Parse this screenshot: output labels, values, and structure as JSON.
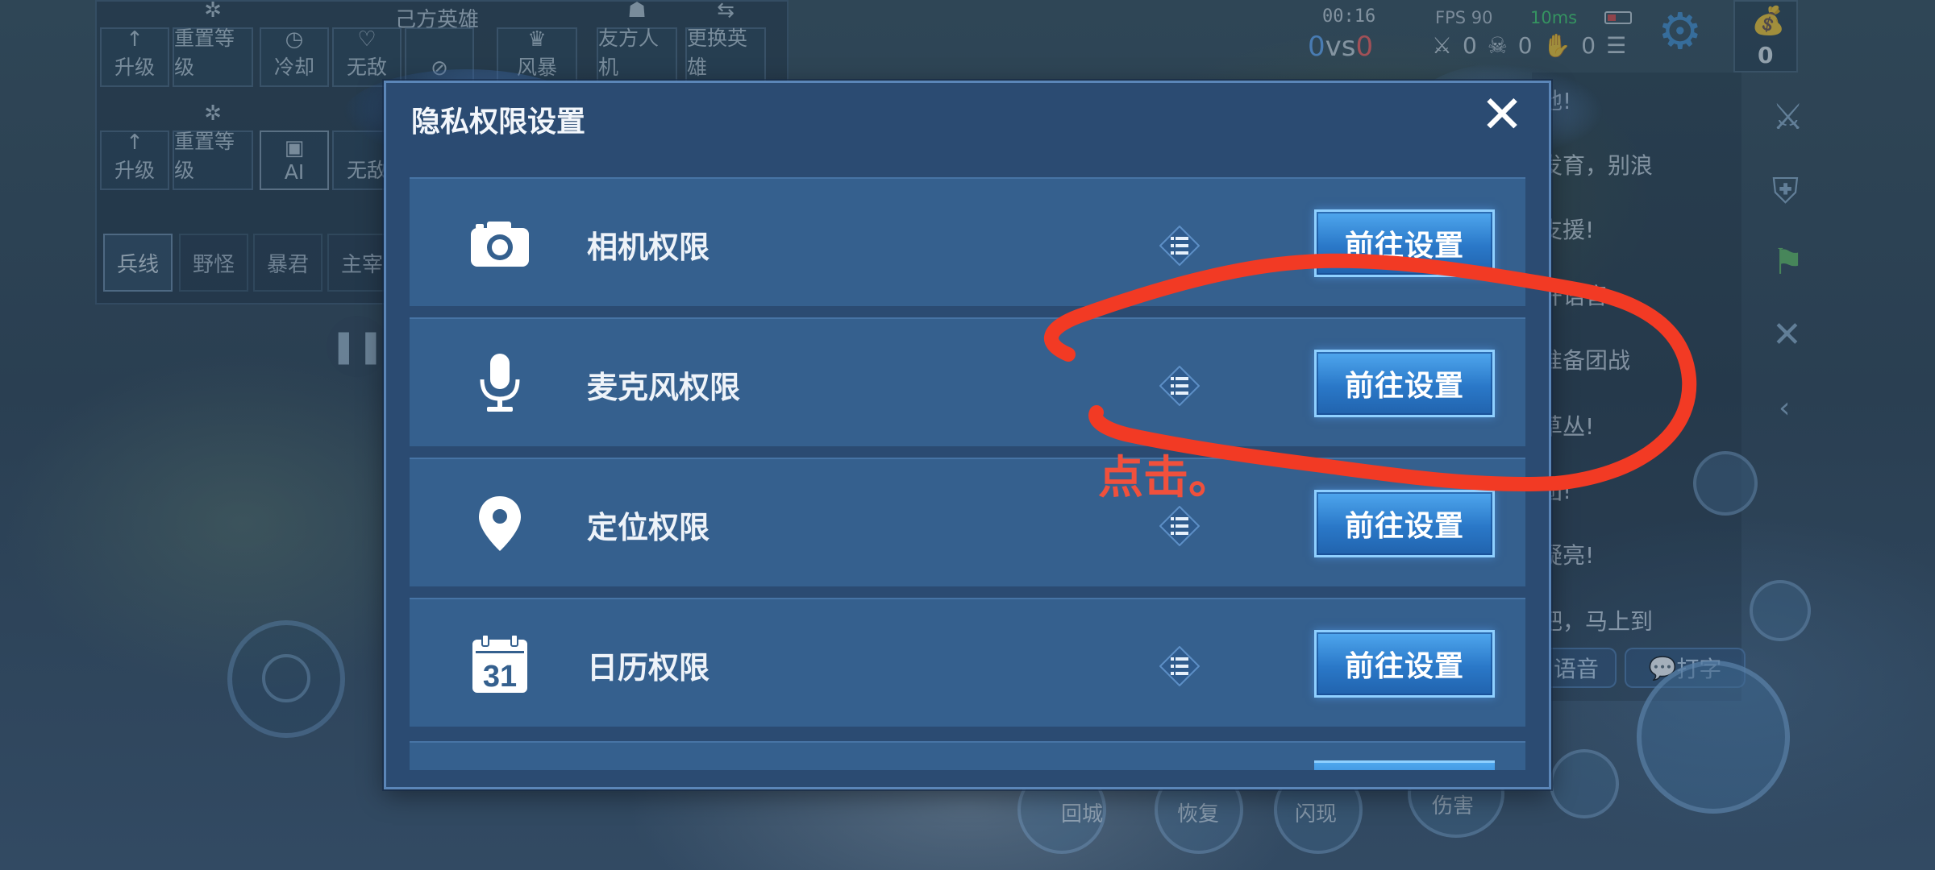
{
  "background": {
    "cheat_panel": {
      "title": "己方英雄",
      "row1": [
        {
          "icon": "arrow-up-icon",
          "label": "升级"
        },
        {
          "icon": "gear-small-icon",
          "label": "重置等级"
        },
        {
          "icon": "clock-icon",
          "label": "冷却"
        },
        {
          "icon": "heart-icon",
          "label": "无敌"
        },
        {
          "icon": "no-icon",
          "label": ""
        },
        {
          "icon": "storm-icon",
          "label": "风暴"
        },
        {
          "icon": "helmet-icon",
          "label": "友方人机"
        },
        {
          "icon": "swap-icon",
          "label": "更换英雄"
        }
      ],
      "row2": [
        {
          "icon": "arrow-up-icon",
          "label": "升级"
        },
        {
          "icon": "gear-small-icon",
          "label": "重置等级"
        },
        {
          "icon": "ai-icon",
          "label": "AI"
        },
        {
          "icon": "none",
          "label": "无敌"
        }
      ],
      "tabs": [
        "兵线",
        "野怪",
        "暴君",
        "主宰"
      ]
    },
    "topbar": {
      "time": "00:16",
      "score_blue": "0",
      "vs": "vs",
      "score_red": "0",
      "fps": "FPS 90",
      "ping": "10ms",
      "kda": [
        "0",
        "0",
        "0"
      ],
      "gold": "0"
    },
    "chat_lines": [
      "地!",
      "发育，别浪",
      "支援!",
      "开语音",
      "准备团战",
      "草丛!",
      "团!",
      "疑亮!",
      "吧，马上到"
    ],
    "chat_buttons": [
      "语音",
      "打字"
    ],
    "skills": [
      "回城",
      "恢复",
      "闪现",
      "伤害"
    ]
  },
  "modal": {
    "title": "隐私权限设置",
    "close_icon": "close-icon",
    "rows": [
      {
        "icon": "camera-icon",
        "label": "相机权限",
        "button": "前往设置"
      },
      {
        "icon": "microphone-icon",
        "label": "麦克风权限",
        "button": "前往设置"
      },
      {
        "icon": "location-pin-icon",
        "label": "定位权限",
        "button": "前往设置"
      },
      {
        "icon": "calendar-icon",
        "label": "日历权限",
        "button": "前往设置",
        "calendar_day": "31"
      }
    ]
  },
  "annotation": {
    "text": "点击。",
    "color": "#f0503c"
  },
  "colors": {
    "modal_bg": "#2b4b72",
    "row_bg": "#35608e",
    "button_blue": "#2a78c8",
    "accent_gear": "#3f8fd6"
  }
}
